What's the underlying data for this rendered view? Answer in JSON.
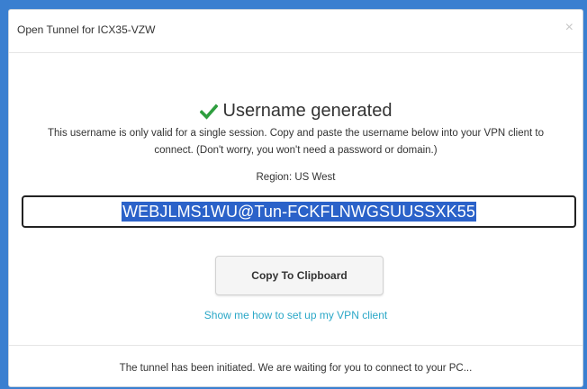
{
  "modal": {
    "title": "Open Tunnel for ICX35-VZW",
    "close_label": "×"
  },
  "body": {
    "headline": "Username generated",
    "check_icon": "checkmark-icon",
    "description": "This username is only valid for a single session. Copy and paste the username below into your VPN client to connect. (Don't worry, you won't need a password or domain.)",
    "region": "Region: US West",
    "username": "WEBJLMS1WU@Tun-FCKFLNWGSUUSSXK55",
    "copy_button": "Copy To Clipboard",
    "help_link": "Show me how to set up my VPN client"
  },
  "footer": {
    "status": "The tunnel has been initiated. We are waiting for you to connect to your PC..."
  },
  "colors": {
    "background": "#3a7fd0",
    "check": "#2e9e3e",
    "selection": "#2b62c9",
    "link": "#2aa7c7"
  }
}
